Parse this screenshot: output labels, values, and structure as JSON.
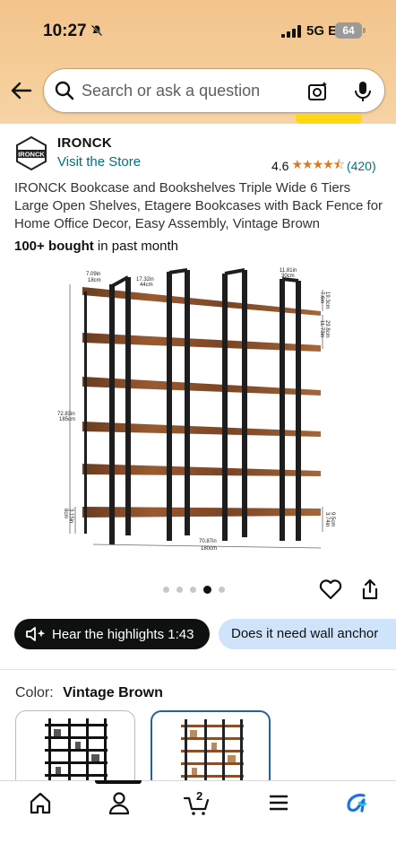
{
  "status": {
    "time": "10:27",
    "network": "5G E",
    "battery": "64"
  },
  "search": {
    "placeholder": "Search or ask a question"
  },
  "brand": {
    "name": "IRONCK",
    "logo_text": "IRONCK",
    "visit_link": "Visit the Store"
  },
  "rating": {
    "value": "4.6",
    "stars": "★★★★⯪",
    "count": "(420)"
  },
  "product": {
    "title": "IRONCK Bookcase and Bookshelves Triple Wide 6 Tiers Large Open Shelves, Etagere Bookcases with Back Fence for Home Office Decor, Easy Assembly, Vintage Brown",
    "bought_bold": "100+ bought",
    "bought_rest": " in past month"
  },
  "image_dims": {
    "d1": "7.09in",
    "d1b": "18cm",
    "d2": "17.32in",
    "d2b": "44cm",
    "d3": "11.81in",
    "d3b": "30cm",
    "d4": "7.6in",
    "d4b": "19.3cm",
    "d5": "11.73in",
    "d5b": "29.8cm",
    "d6": "72.83in",
    "d6b": "185cm",
    "d7": "3.15in",
    "d7b": "8cm",
    "d8": "70.87in",
    "d8b": "180cm",
    "d9": "3.74in",
    "d9b": "9.5cm"
  },
  "carousel": {
    "count": 5,
    "active_index": 3
  },
  "actions": {
    "hear_label": "Hear the highlights 1:43",
    "question_label": "Does it need wall anchor"
  },
  "color": {
    "label": "Color:",
    "value": "Vintage Brown"
  },
  "nav": {
    "cart_count": "2"
  },
  "colors": {
    "link": "#007185",
    "star": "#de7921",
    "selected_border": "#2162a1",
    "header_bg": "#f2c48c"
  }
}
